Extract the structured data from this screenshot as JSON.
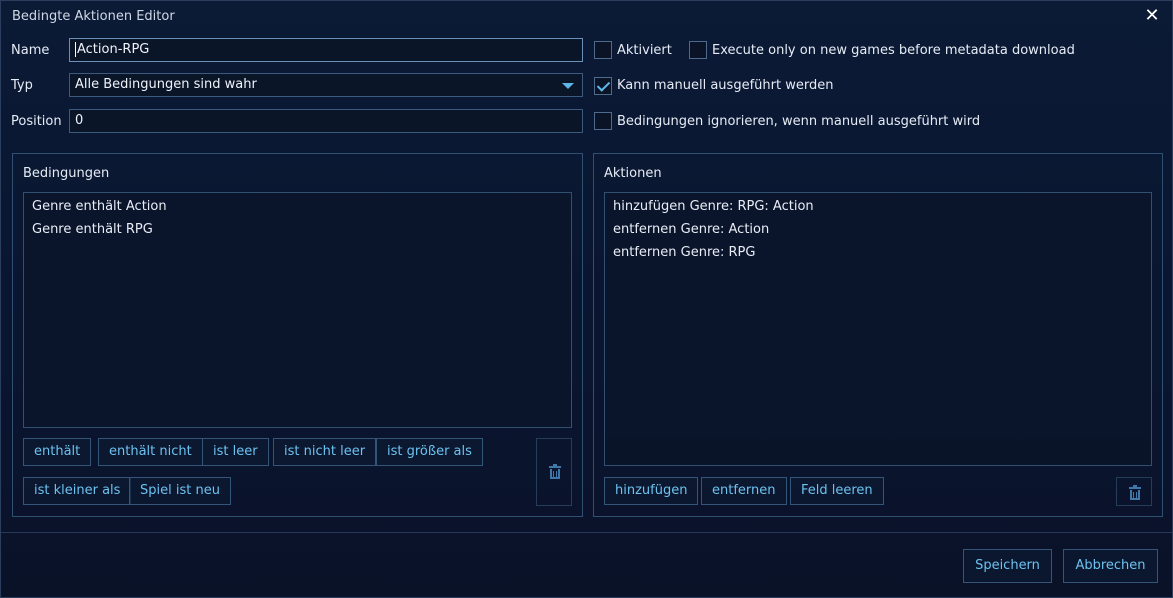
{
  "window": {
    "title": "Bedingte Aktionen Editor"
  },
  "form": {
    "name_label": "Name",
    "name_value": "Action-RPG",
    "type_label": "Typ",
    "type_value": "Alle Bedingungen sind wahr",
    "position_label": "Position",
    "position_value": "0"
  },
  "options": {
    "enabled": {
      "label": "Aktiviert",
      "checked": false
    },
    "new_games_only": {
      "label": "Execute only on new games before metadata download",
      "checked": false
    },
    "manual": {
      "label": "Kann manuell ausgeführt werden",
      "checked": true
    },
    "ignore_conditions": {
      "label": "Bedingungen ignorieren, wenn manuell ausgeführt wird",
      "checked": false
    }
  },
  "conditions": {
    "title": "Bedingungen",
    "items": [
      "Genre enthält Action",
      "Genre enthält RPG"
    ],
    "buttons": [
      "enthält",
      "enthält nicht",
      "ist leer",
      "ist nicht leer",
      "ist größer als",
      "ist kleiner als",
      "Spiel ist neu"
    ]
  },
  "actions": {
    "title": "Aktionen",
    "items": [
      "hinzufügen Genre: RPG: Action",
      "entfernen Genre: Action",
      "entfernen Genre: RPG"
    ],
    "buttons": [
      "hinzufügen",
      "entfernen",
      "Feld leeren"
    ]
  },
  "footer": {
    "save": "Speichern",
    "cancel": "Abbrechen"
  },
  "colors": {
    "accent": "#5fb7e9",
    "border": "#2f5070",
    "background": "#0b1a35"
  }
}
